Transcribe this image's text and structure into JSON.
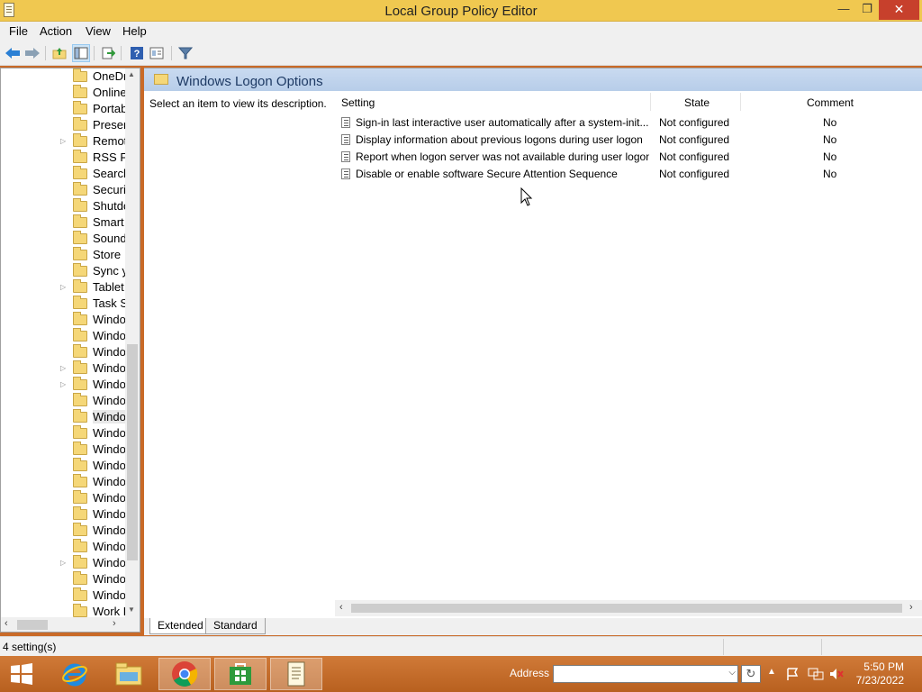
{
  "window": {
    "title": "Local Group Policy Editor",
    "minimize": "—",
    "maximize": "❐",
    "close": "✕"
  },
  "menu": [
    "File",
    "Action",
    "View",
    "Help"
  ],
  "tree": {
    "items": [
      {
        "label": "OneDr",
        "expandable": false
      },
      {
        "label": "Online",
        "expandable": false
      },
      {
        "label": "Portab",
        "expandable": false
      },
      {
        "label": "Presen",
        "expandable": false
      },
      {
        "label": "Remot",
        "expandable": true
      },
      {
        "label": "RSS Fe",
        "expandable": false
      },
      {
        "label": "Search",
        "expandable": false
      },
      {
        "label": "Securit",
        "expandable": false
      },
      {
        "label": "Shutdo",
        "expandable": false
      },
      {
        "label": "Smart",
        "expandable": false
      },
      {
        "label": "Sound",
        "expandable": false
      },
      {
        "label": "Store",
        "expandable": false
      },
      {
        "label": "Sync y",
        "expandable": false
      },
      {
        "label": "Tablet",
        "expandable": true
      },
      {
        "label": "Task S",
        "expandable": false
      },
      {
        "label": "Windo",
        "expandable": false
      },
      {
        "label": "Windo",
        "expandable": false
      },
      {
        "label": "Windo",
        "expandable": false
      },
      {
        "label": "Windo",
        "expandable": true
      },
      {
        "label": "Windo",
        "expandable": true
      },
      {
        "label": "Windo",
        "expandable": false
      },
      {
        "label": "Windo",
        "expandable": false,
        "selected": true
      },
      {
        "label": "Windo",
        "expandable": false
      },
      {
        "label": "Windo",
        "expandable": false
      },
      {
        "label": "Windo",
        "expandable": false
      },
      {
        "label": "Windo",
        "expandable": false
      },
      {
        "label": "Windo",
        "expandable": false
      },
      {
        "label": "Windo",
        "expandable": false
      },
      {
        "label": "Windo",
        "expandable": false
      },
      {
        "label": "Windo",
        "expandable": false
      },
      {
        "label": "Windo",
        "expandable": true
      },
      {
        "label": "Windo",
        "expandable": false
      },
      {
        "label": "Windo",
        "expandable": false
      },
      {
        "label": "Work F",
        "expandable": false
      }
    ]
  },
  "content": {
    "heading": "Windows Logon Options",
    "description": "Select an item to view its description.",
    "columns": {
      "setting": "Setting",
      "state": "State",
      "comment": "Comment"
    },
    "rows": [
      {
        "setting": "Sign-in last interactive user automatically after a system-init...",
        "state": "Not configured",
        "comment": "No"
      },
      {
        "setting": "Display information about previous logons during user logon",
        "state": "Not configured",
        "comment": "No"
      },
      {
        "setting": "Report when logon server was not available during user logon",
        "state": "Not configured",
        "comment": "No"
      },
      {
        "setting": "Disable or enable software Secure Attention Sequence",
        "state": "Not configured",
        "comment": "No"
      }
    ]
  },
  "tabs": {
    "extended": "Extended",
    "standard": "Standard"
  },
  "status": {
    "text": "4 setting(s)"
  },
  "taskbar": {
    "address_label": "Address",
    "time": "5:50 PM",
    "date": "7/23/2022"
  },
  "colors": {
    "title_bar": "#f0c850",
    "taskbar": "#c96a28",
    "header": "#c9daf0"
  }
}
